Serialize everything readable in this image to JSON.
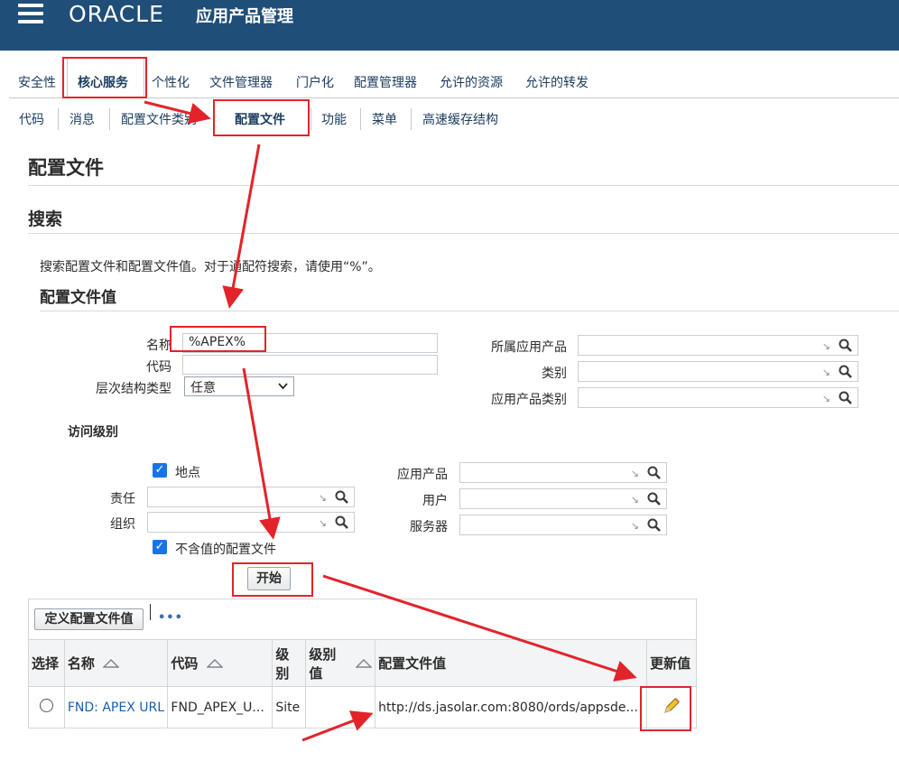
{
  "header": {
    "logo": "ORACLE",
    "app_title": "应用产品管理"
  },
  "tabs": [
    "安全性",
    "核心服务",
    "个性化",
    "文件管理器",
    "门户化",
    "配置管理器",
    "允许的资源",
    "允许的转发"
  ],
  "subtabs": [
    "代码",
    "消息",
    "配置文件类别",
    "配置文件",
    "功能",
    "菜单",
    "高速缓存结构"
  ],
  "page_title": "配置文件",
  "search": {
    "title": "搜索",
    "instruction": "搜索配置文件和配置文件值。对于通配符搜索，请使用“%”。",
    "section_title": "配置文件值",
    "name_label": "名称",
    "name_value": "%APEX%",
    "code_label": "代码",
    "code_value": "",
    "hier_label": "层次结构类型",
    "hier_value": "任意",
    "app_product_label": "所属应用产品",
    "category_label": "类别",
    "app_category_label": "应用产品类别",
    "access_level_label": "访问级别",
    "site_label": "地点",
    "responsibility_label": "责任",
    "org_label": "组织",
    "application_label": "应用产品",
    "user_label": "用户",
    "server_label": "服务器",
    "no_value_label": "不含值的配置文件",
    "go_button": "开始"
  },
  "results": {
    "define_button": "定义配置文件值",
    "more": "•••",
    "columns": [
      "选择",
      "名称",
      "代码",
      "级别",
      "级别值",
      "配置文件值",
      "更新值"
    ],
    "rows": [
      {
        "name": "FND: APEX URL",
        "code": "FND_APEX_U...",
        "level": "Site",
        "level_value": "",
        "value": "http://ds.jasolar.com:8080/ords/appsde..."
      }
    ]
  },
  "icons": {
    "edit": "pencil-icon",
    "search": "search-icon",
    "sort": "sort-triangle-icon"
  },
  "colors": {
    "header": "#1f4e79",
    "annotation": "#e3232a",
    "link": "#1c3e60"
  }
}
